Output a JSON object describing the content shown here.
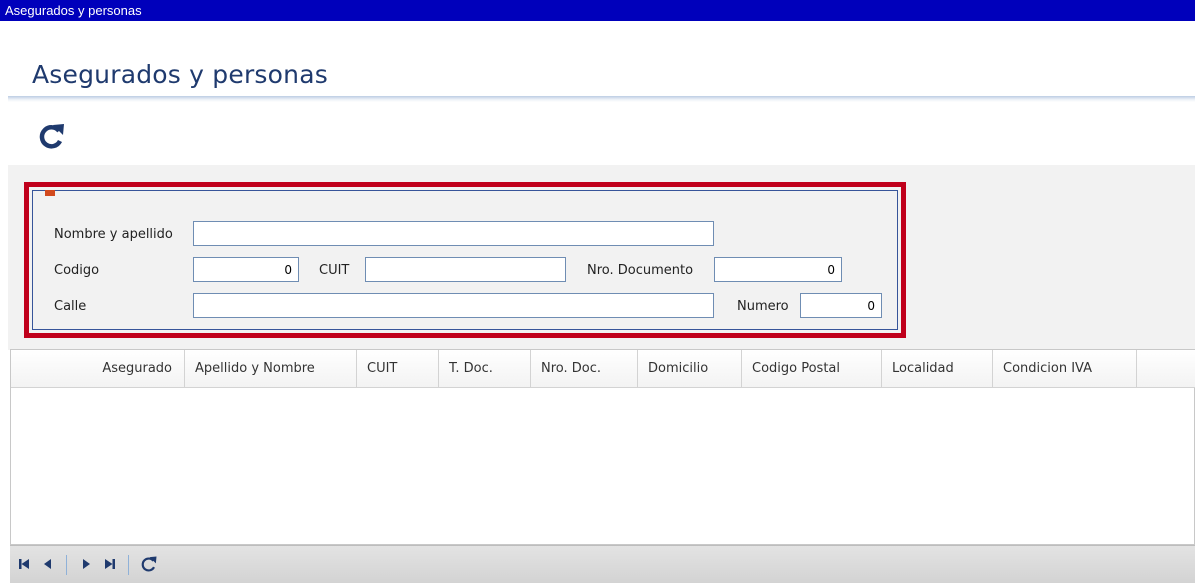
{
  "window": {
    "title": "Asegurados y personas"
  },
  "page": {
    "title": "Asegurados y personas"
  },
  "toolbar": {
    "refresh_icon": "refresh-icon"
  },
  "filters": {
    "nombre_label": "Nombre y apellido",
    "nombre_value": "",
    "codigo_label": "Codigo",
    "codigo_value": "0",
    "cuit_label": "CUIT",
    "cuit_value": "",
    "nro_documento_label": "Nro. Documento",
    "nro_documento_value": "0",
    "calle_label": "Calle",
    "calle_value": "",
    "numero_label": "Numero",
    "numero_value": "0"
  },
  "grid": {
    "columns": [
      "Asegurado",
      "Apellido y Nombre",
      "CUIT",
      "T. Doc.",
      "Nro. Doc.",
      "Domicilio",
      "Codigo Postal",
      "Localidad",
      "Condicion IVA"
    ],
    "rows": []
  },
  "pager": {
    "icons": [
      "first-page-icon",
      "previous-page-icon",
      "next-page-icon",
      "last-page-icon",
      "refresh-icon"
    ]
  },
  "colors": {
    "titlebar": "#0000bb",
    "title_text": "#1f3a6e",
    "highlight_border": "#c0001c",
    "input_border": "#6f8db3"
  }
}
